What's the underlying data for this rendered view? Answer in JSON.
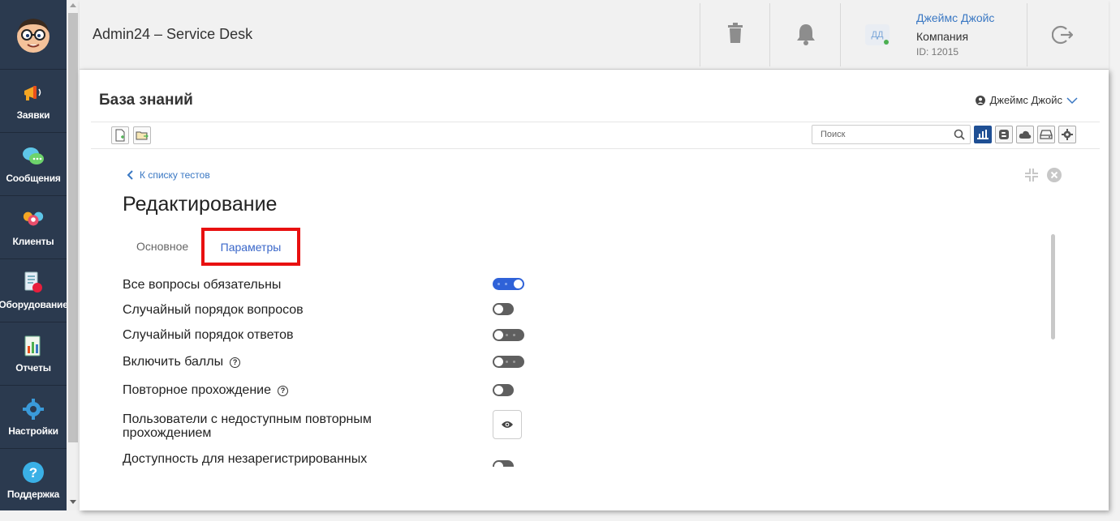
{
  "app": {
    "title": "Admin24 – Service Desk"
  },
  "sidebar": {
    "items": [
      {
        "label": "Заявки",
        "icon": "megaphone-icon"
      },
      {
        "label": "Сообщения",
        "icon": "chat-bubbles-icon"
      },
      {
        "label": "Клиенты",
        "icon": "clients-icon"
      },
      {
        "label": "Оборудование",
        "icon": "equipment-icon"
      },
      {
        "label": "Отчеты",
        "icon": "report-icon"
      },
      {
        "label": "Настройки",
        "icon": "gear-icon"
      },
      {
        "label": "Поддержка",
        "icon": "help-icon"
      }
    ]
  },
  "header": {
    "avatar_initials": "ДД",
    "user_name": "Джеймс Джойс",
    "company": "Компания",
    "user_id": "ID: 12015"
  },
  "page": {
    "title": "База знаний",
    "author": "Джеймс Джойс",
    "search_placeholder": "Поиск",
    "back_link": "К списку тестов",
    "edit_title": "Редактирование",
    "tabs": [
      {
        "label": "Основное",
        "active": false
      },
      {
        "label": "Параметры",
        "active": true
      }
    ]
  },
  "settings": [
    {
      "label": "Все вопросы обязательны",
      "on": true,
      "help": false
    },
    {
      "label": "Случайный порядок вопросов",
      "on": false,
      "help": false
    },
    {
      "label": "Случайный порядок ответов",
      "on": false,
      "help": false
    },
    {
      "label": "Включить баллы",
      "on": false,
      "help": true
    },
    {
      "label": "Повторное прохождение",
      "on": false,
      "help": true
    },
    {
      "label": "Пользователи с недоступным повторным прохождением",
      "control": "eye-button"
    },
    {
      "label": "Доступность для незарегистрированных",
      "on": false,
      "help": false
    }
  ],
  "colors": {
    "sidebar": "#2b3a4f",
    "accent": "#3a78c3",
    "toggle_on": "#2f62d8",
    "highlight": "#e81010"
  }
}
